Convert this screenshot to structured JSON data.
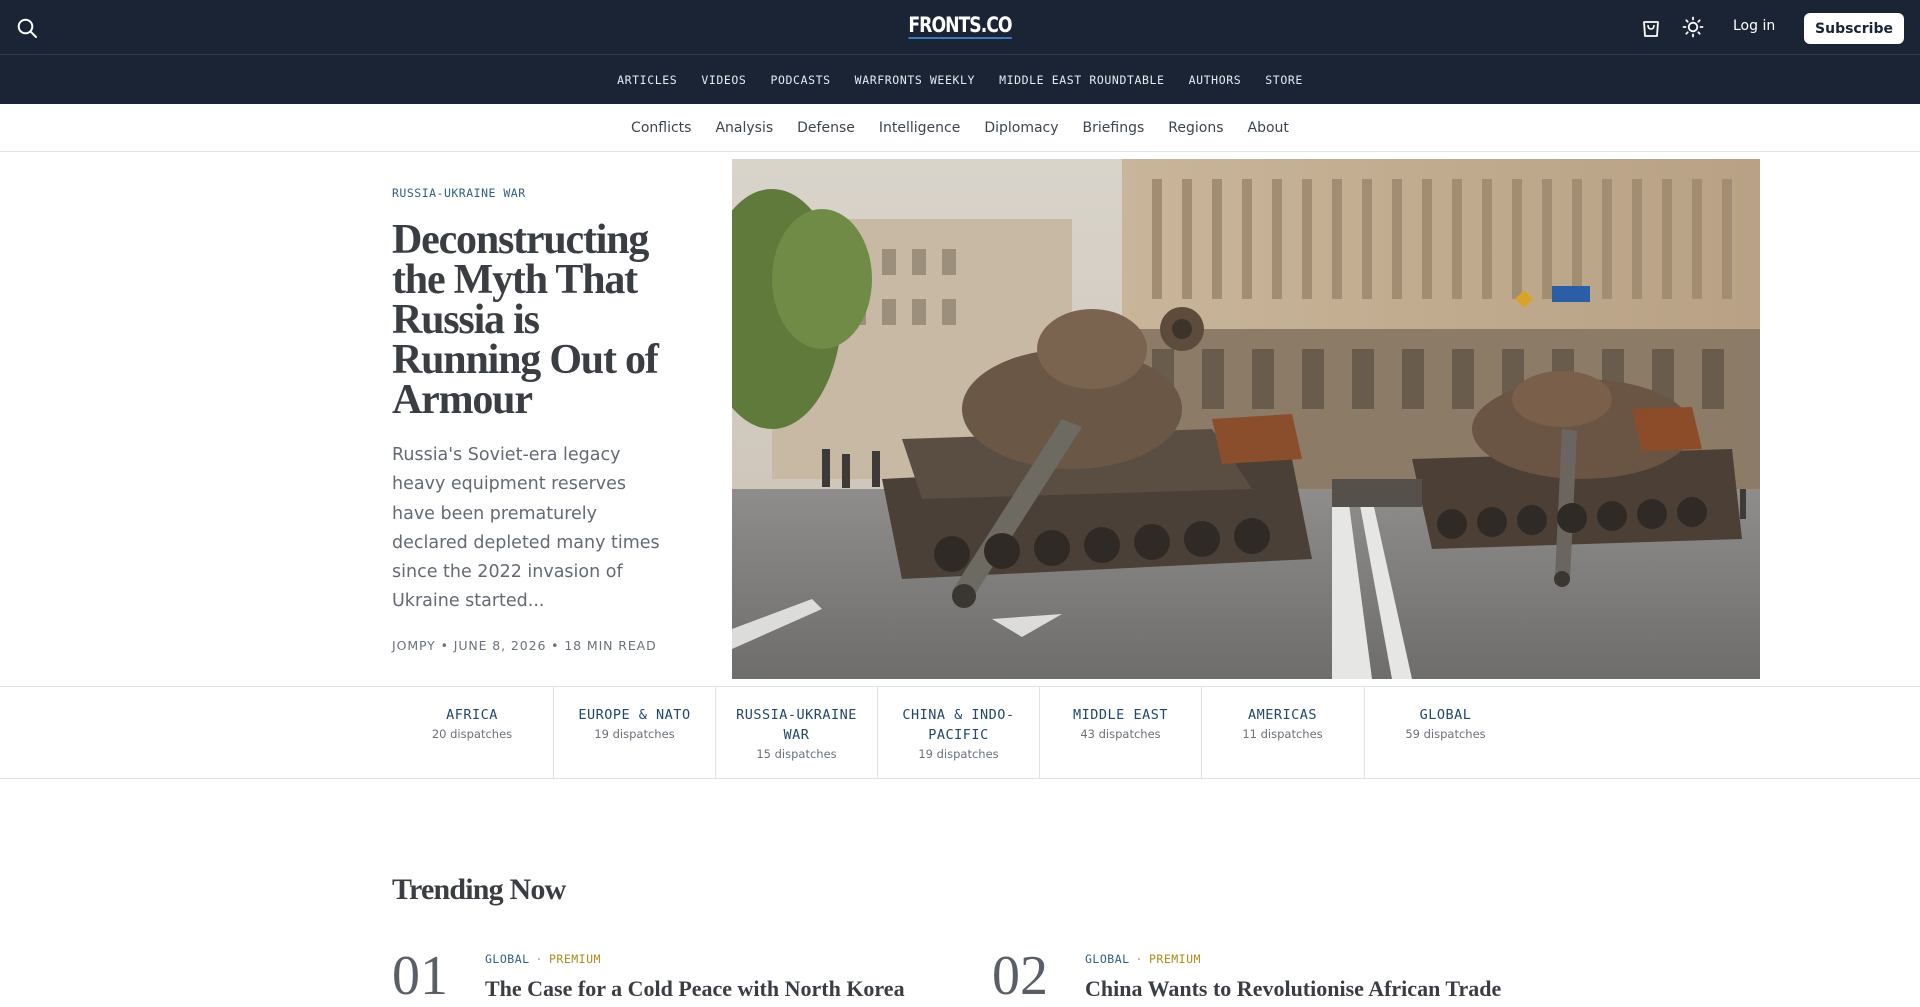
{
  "header": {
    "logo": "FRONTS.CO",
    "login_label": "Log in",
    "subscribe_label": "Subscribe",
    "icons": [
      "search-icon",
      "cart-icon",
      "sun-icon"
    ]
  },
  "section_nav": [
    "ARTICLES",
    "VIDEOS",
    "PODCASTS",
    "WARFRONTS WEEKLY",
    "MIDDLE EAST ROUNDTABLE",
    "AUTHORS",
    "STORE"
  ],
  "category_nav": [
    "Conflicts",
    "Analysis",
    "Defense",
    "Intelligence",
    "Diplomacy",
    "Briefings",
    "Regions",
    "About"
  ],
  "hero": {
    "kicker": "RUSSIA-UKRAINE WAR",
    "headline": "Deconstructing the Myth That Russia is Running Out of Armour",
    "excerpt": "Russia's Soviet-era legacy heavy equipment reserves have been prematurely declared depleted many times since the 2022 invasion of Ukraine started...",
    "byline": "JOMPY • JUNE 8, 2026 • 18 MIN READ"
  },
  "regions": [
    {
      "name": "AFRICA",
      "count": "20 dispatches"
    },
    {
      "name": "EUROPE & NATO",
      "count": "19 dispatches"
    },
    {
      "name": "RUSSIA-UKRAINE WAR",
      "count": "15 dispatches"
    },
    {
      "name": "CHINA & INDO-PACIFIC",
      "count": "19 dispatches"
    },
    {
      "name": "MIDDLE EAST",
      "count": "43 dispatches"
    },
    {
      "name": "AMERICAS",
      "count": "11 dispatches"
    },
    {
      "name": "GLOBAL",
      "count": "59 dispatches"
    }
  ],
  "trending": {
    "title": "Trending Now",
    "items": [
      {
        "num": "01",
        "region": "GLOBAL",
        "sep": "·",
        "tier": "PREMIUM",
        "headline": "The Case for a Cold Peace with North Korea"
      },
      {
        "num": "02",
        "region": "GLOBAL",
        "sep": "·",
        "tier": "PREMIUM",
        "headline": "China Wants to Revolutionise African Trade"
      }
    ]
  }
}
